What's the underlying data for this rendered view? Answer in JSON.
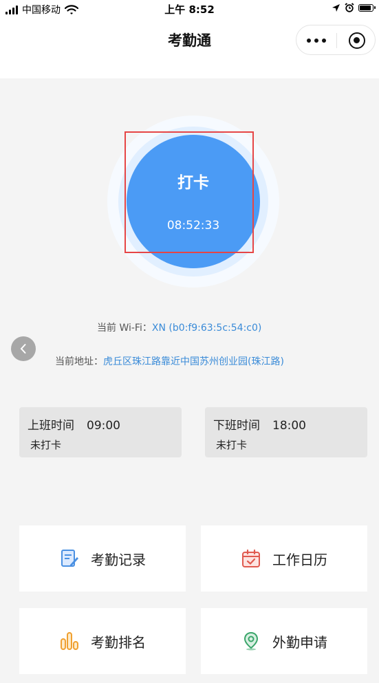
{
  "status_bar": {
    "carrier": "中国移动",
    "time": "上午 8:52"
  },
  "nav": {
    "title": "考勤通"
  },
  "punch": {
    "label": "打卡",
    "time": "08:52:33"
  },
  "wifi": {
    "label": "当前 Wi-Fi：",
    "value": "XN (b0:f9:63:5c:54:c0)"
  },
  "location": {
    "label": "当前地址：",
    "value": "虎丘区珠江路靠近中国苏州创业园(珠江路)"
  },
  "shifts": [
    {
      "title": "上班时间",
      "time": "09:00",
      "status": "未打卡"
    },
    {
      "title": "下班时间",
      "time": "18:00",
      "status": "未打卡"
    }
  ],
  "menu": [
    {
      "label": "考勤记录",
      "icon": "document-edit-icon",
      "color": "#4a90e2"
    },
    {
      "label": "工作日历",
      "icon": "calendar-check-icon",
      "color": "#e05a4f"
    },
    {
      "label": "考勤排名",
      "icon": "bar-chart-icon",
      "color": "#f0a030"
    },
    {
      "label": "外勤申请",
      "icon": "location-pin-icon",
      "color": "#3aa56a"
    }
  ],
  "colors": {
    "primary": "#4b9bf5",
    "link": "#3a8bd8",
    "highlight_box": "#e64545"
  }
}
